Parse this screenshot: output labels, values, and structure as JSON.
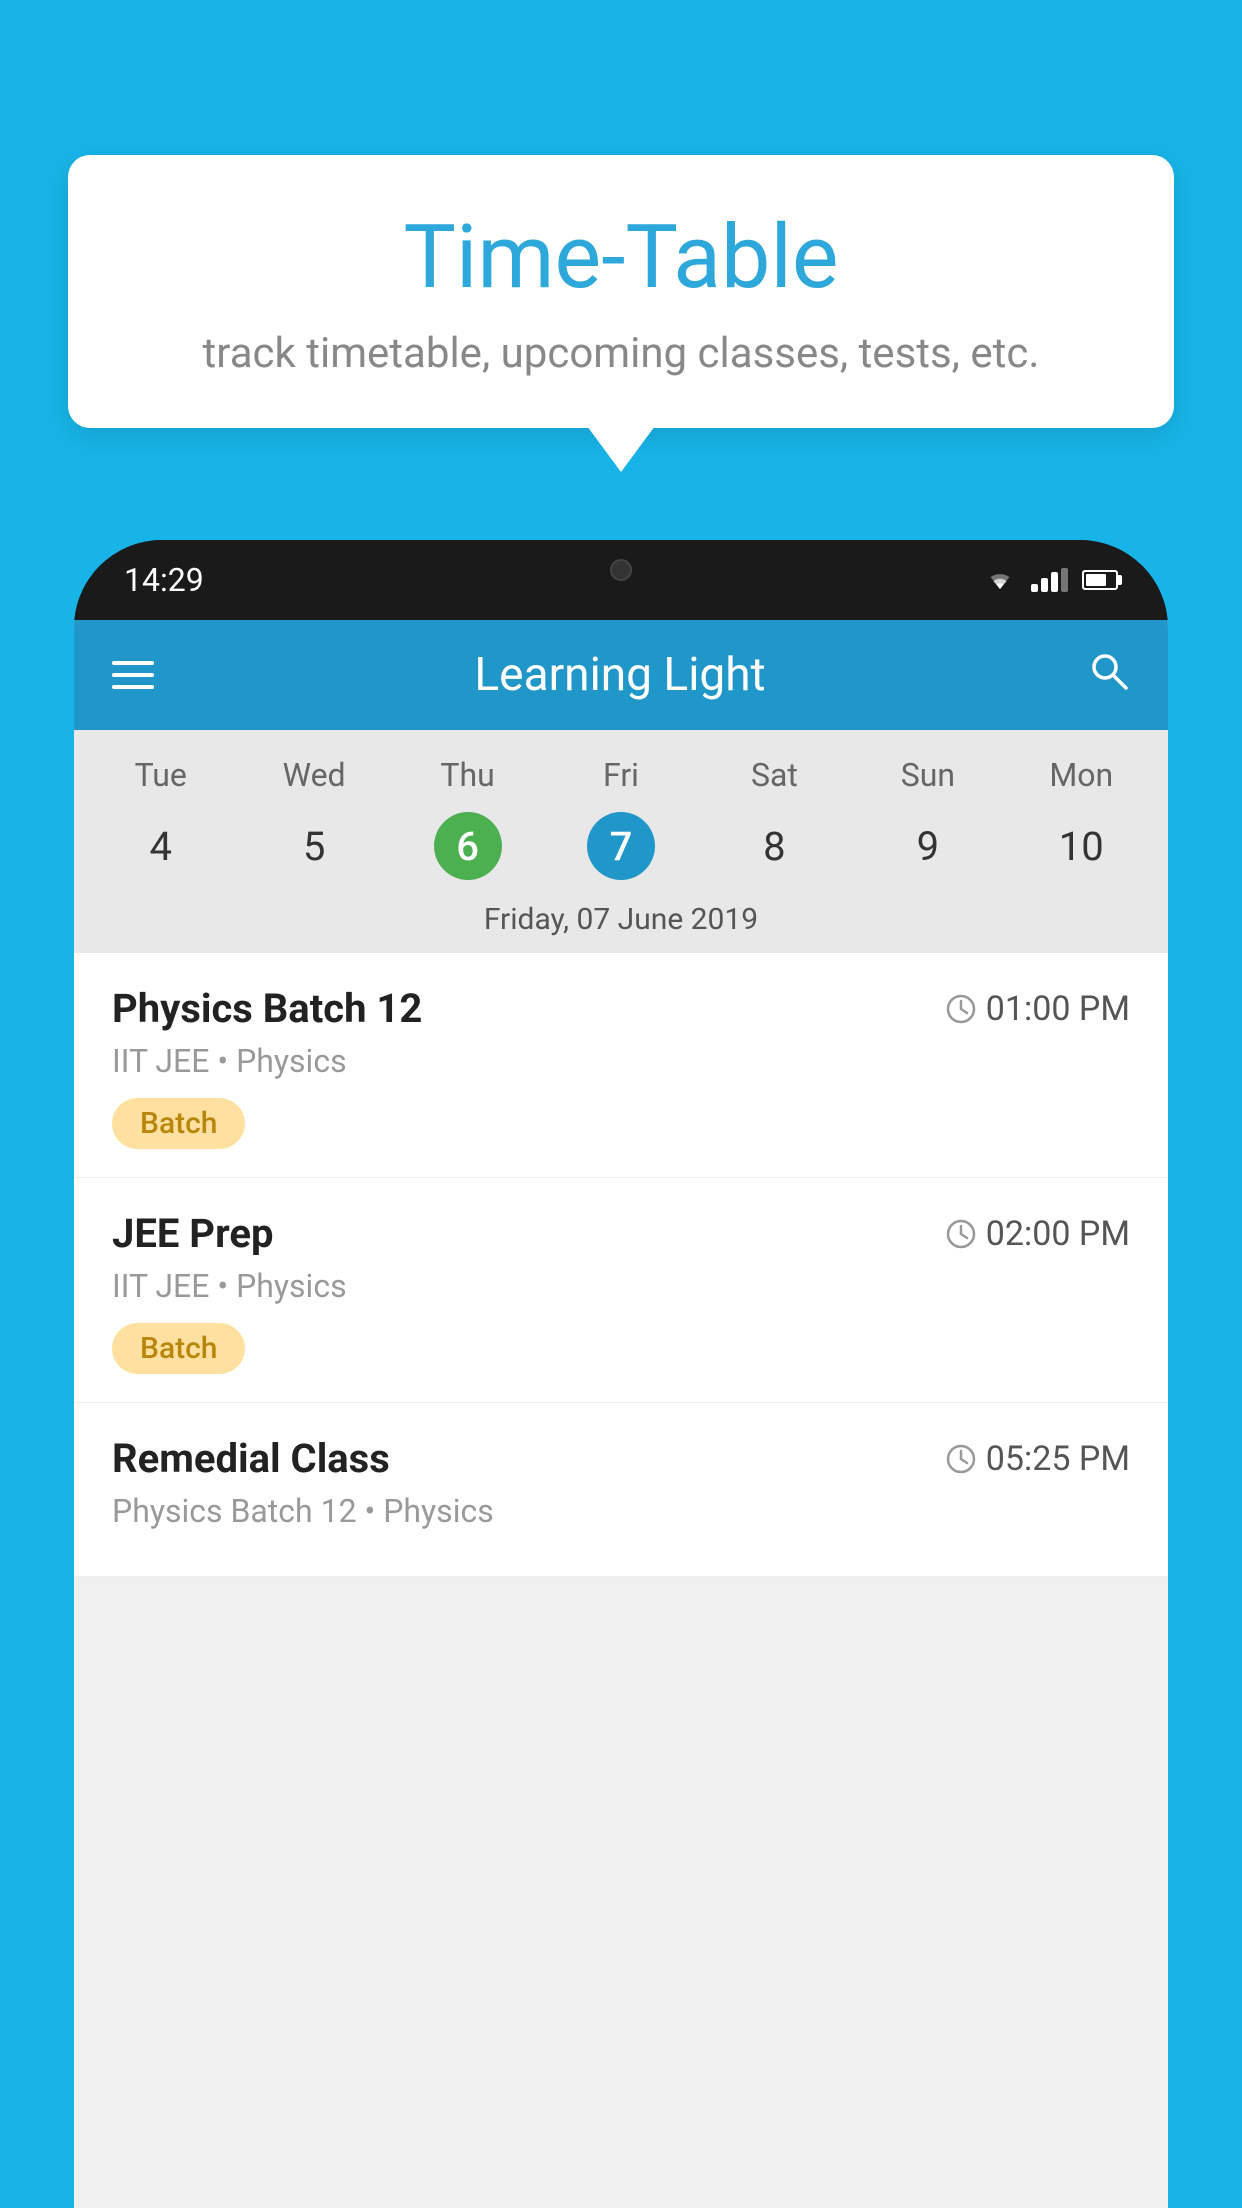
{
  "page": {
    "background_color": "#18b4e8"
  },
  "tooltip": {
    "title": "Time-Table",
    "subtitle": "track timetable, upcoming classes, tests, etc."
  },
  "phone": {
    "time": "14:29",
    "app_title": "Learning Light",
    "calendar": {
      "days": [
        "Tue",
        "Wed",
        "Thu",
        "Fri",
        "Sat",
        "Sun",
        "Mon"
      ],
      "dates": [
        "4",
        "5",
        "6",
        "7",
        "8",
        "9",
        "10"
      ],
      "today_index": 2,
      "selected_index": 3,
      "selected_label": "Friday, 07 June 2019"
    },
    "schedule": [
      {
        "title": "Physics Batch 12",
        "time": "01:00 PM",
        "subtitle": "IIT JEE • Physics",
        "badge": "Batch"
      },
      {
        "title": "JEE Prep",
        "time": "02:00 PM",
        "subtitle": "IIT JEE • Physics",
        "badge": "Batch"
      },
      {
        "title": "Remedial Class",
        "time": "05:25 PM",
        "subtitle": "Physics Batch 12 • Physics",
        "badge": ""
      }
    ]
  },
  "icons": {
    "hamburger": "≡",
    "search": "🔍",
    "clock": "🕐"
  }
}
